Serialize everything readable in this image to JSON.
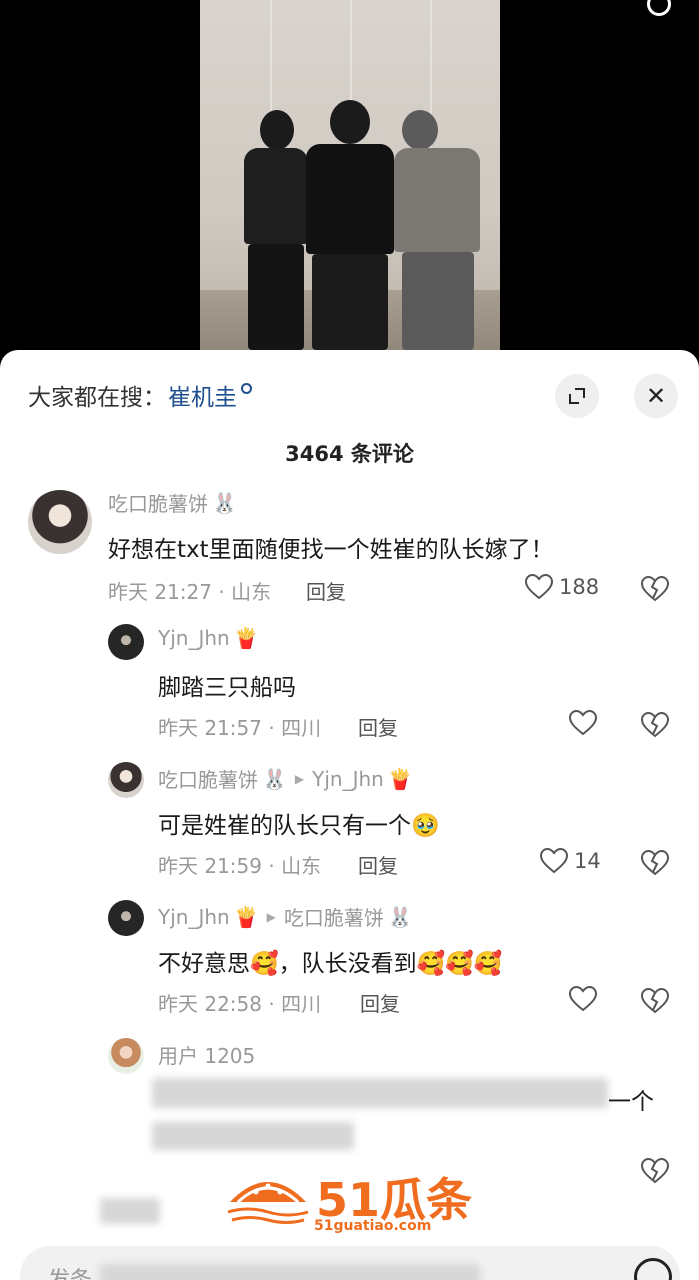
{
  "sheet": {
    "search_prefix": "大家都在搜：",
    "search_keyword": "崔机圭",
    "comment_count": "3464 条评论"
  },
  "comments": [
    {
      "user": "吃口脆薯饼",
      "badge": "🐰",
      "text": "好想在txt里面随便找一个姓崔的队长嫁了！",
      "time_loc": "昨天 21:27 · 山东",
      "reply": "回复",
      "likes": "188"
    },
    {
      "user": "Yjn_Jhn",
      "badge": "🍟",
      "text": "脚踏三只船吗",
      "time_loc": "昨天 21:57 · 四川",
      "reply": "回复",
      "likes": ""
    },
    {
      "user": "吃口脆薯饼",
      "badge": "🐰",
      "reply_to": "Yjn_Jhn",
      "reply_to_badge": "🍟",
      "text": "可是姓崔的队长只有一个🥹",
      "time_loc": "昨天 21:59 · 山东",
      "reply": "回复",
      "likes": "14"
    },
    {
      "user": "Yjn_Jhn",
      "badge": "🍟",
      "reply_to": "吃口脆薯饼",
      "reply_to_badge": "🐰",
      "text": "不好意思🥰，队长没看到🥰🥰🥰",
      "time_loc": "昨天 22:58 · 四川",
      "reply": "回复",
      "likes": ""
    },
    {
      "user": "用户 1205",
      "text_tail": "一个"
    }
  ],
  "watermark": {
    "brand": "51瓜条",
    "site": "51guatiao.com"
  },
  "input": {
    "placeholder": "发条"
  },
  "icons": {
    "expand": "expand-icon",
    "close": "close-icon",
    "like": "heart-icon",
    "dislike": "broken-heart-icon",
    "emoji": "emoji-icon"
  },
  "colors": {
    "keyword": "#1e4f8f",
    "watermark": "#f06d1f",
    "meta": "#999999"
  }
}
